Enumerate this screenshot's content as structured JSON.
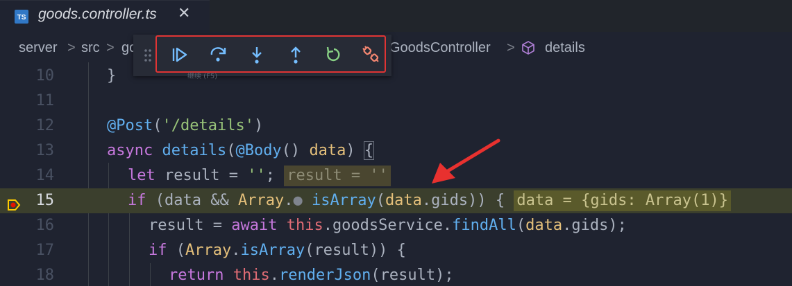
{
  "tab": {
    "icon_label": "TS",
    "title": "goods.controller.ts",
    "close_glyph": "✕"
  },
  "breadcrumb": {
    "items": [
      "server",
      "src",
      "go"
    ],
    "separator": ">",
    "tail": [
      "GoodsController",
      "details"
    ]
  },
  "debug_toolbar": {
    "buttons": [
      "continue",
      "step-over",
      "step-into",
      "step-out",
      "restart",
      "disconnect"
    ],
    "tooltip": "继续 (F5)",
    "highlight_color": "#e03434"
  },
  "code": {
    "lines": [
      {
        "num": "10"
      },
      {
        "num": "11"
      },
      {
        "num": "12"
      },
      {
        "num": "13"
      },
      {
        "num": "14"
      },
      {
        "num": "15"
      },
      {
        "num": "16"
      },
      {
        "num": "17"
      },
      {
        "num": "18"
      }
    ],
    "inline_values": {
      "line14": "result = ''",
      "line15": "data = {gids: Array(1)}"
    }
  },
  "colors": {
    "background": "#1f2330",
    "current_line": "#3b3f2d",
    "annotation_arrow": "#e8312f"
  }
}
